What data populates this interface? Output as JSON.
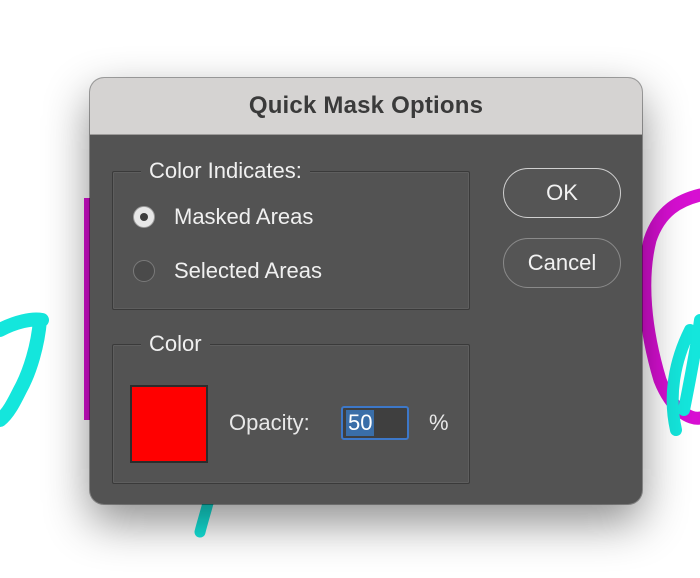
{
  "dialog": {
    "title": "Quick Mask Options"
  },
  "color_indicates": {
    "legend": "Color Indicates:",
    "options": [
      {
        "label": "Masked Areas",
        "selected": true
      },
      {
        "label": "Selected Areas",
        "selected": false
      }
    ]
  },
  "color": {
    "legend": "Color",
    "swatch_color": "#ff0000",
    "opacity_label": "Opacity:",
    "opacity_value": "50",
    "percent_sign": "%"
  },
  "buttons": {
    "ok": "OK",
    "cancel": "Cancel"
  },
  "background_colors": {
    "cyan": "#14e6dc",
    "magenta": "#d70fd2"
  }
}
